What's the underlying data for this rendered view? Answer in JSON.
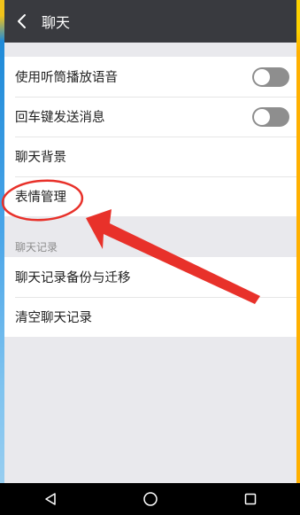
{
  "header": {
    "title": "聊天"
  },
  "settings": [
    {
      "label": "使用听筒播放语音",
      "toggle": false
    },
    {
      "label": "回车键发送消息",
      "toggle": false
    },
    {
      "label": "聊天背景"
    },
    {
      "label": "表情管理"
    }
  ],
  "section_title": "聊天记录",
  "records": [
    {
      "label": "聊天记录备份与迁移"
    },
    {
      "label": "清空聊天记录"
    }
  ],
  "colors": {
    "appbar": "#393a3f",
    "annotation": "#e8312a",
    "toggle_off": "#8e8e8e"
  },
  "icons": [
    "back-arrow-icon",
    "nav-back-icon",
    "nav-home-icon",
    "nav-recent-icon"
  ]
}
